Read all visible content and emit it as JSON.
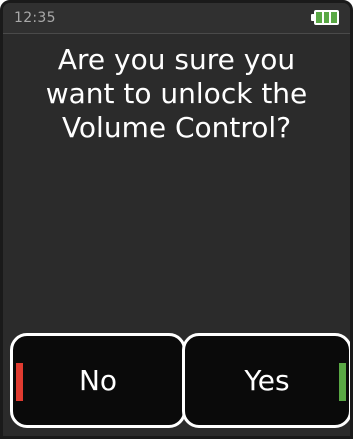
{
  "status_bar": {
    "time": "12:35",
    "battery_icon": "battery-full-icon",
    "battery_level": 1.0,
    "battery_color": "#5aa845"
  },
  "dialog": {
    "message": "Are you sure you want to unlock the Volume Control?"
  },
  "buttons": {
    "no_label": "No",
    "no_accent": "#e03b30",
    "yes_label": "Yes",
    "yes_accent": "#5aa845"
  }
}
